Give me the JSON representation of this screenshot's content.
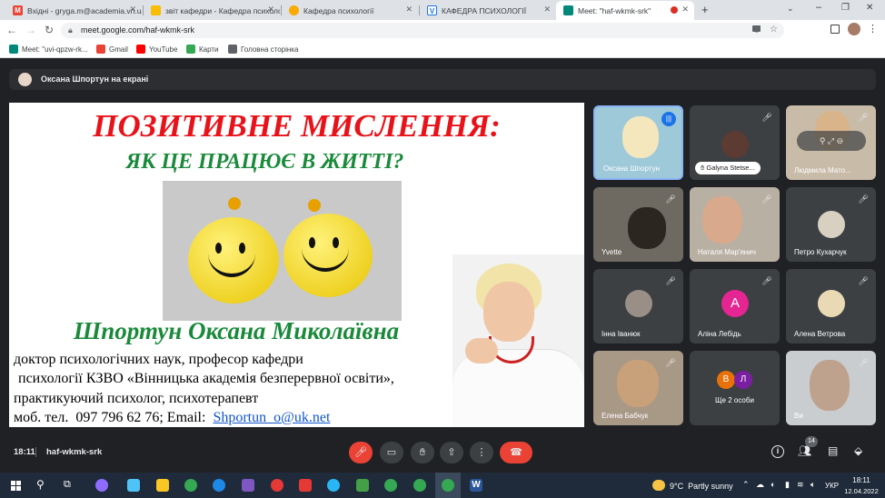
{
  "tabs": [
    {
      "label": "Вхідні - gryga.m@academia.vn.ua",
      "icon": "gmail-icon"
    },
    {
      "label": "звіт кафедри - Кафедра психології",
      "icon": "drive-icon"
    },
    {
      "label": "Кафедра психології",
      "icon": "star-icon"
    },
    {
      "label": "КАФЕДРА ПСИХОЛОГІЇ",
      "icon": "site-icon"
    },
    {
      "label": "Meet: \"haf-wkmk-srk\"",
      "icon": "meet-icon"
    }
  ],
  "address": {
    "url": "meet.google.com/haf-wkmk-srk"
  },
  "bookmarks": [
    {
      "label": "Meet: \"uvi-qpzw-rk...",
      "color": "#00897b"
    },
    {
      "label": "Gmail",
      "color": "#ea4335"
    },
    {
      "label": "YouTube",
      "color": "#ff0000"
    },
    {
      "label": "Карти",
      "color": "#34a853"
    },
    {
      "label": "Головна сторінка",
      "color": "#5f6368"
    }
  ],
  "presenting": {
    "text": "Оксана Шпортун на екрані"
  },
  "slide": {
    "title": "ПОЗИТИВНЕ МИСЛЕННЯ:",
    "subtitle": "ЯК ЦЕ ПРАЦЮЄ В ЖИТТІ?",
    "name": "Шпортун Оксана Миколаївна",
    "line1": "доктор психологічних наук, професор кафедри",
    "line2": "психології КЗВО «Вінницька академія безперервної освіти»,",
    "line3": "практикуючий психолог, психотерапевт",
    "line4_prefix": "моб. тел.  097 796 62 76; Email:  ",
    "email": "Shportun_o@uk.net"
  },
  "participants": [
    {
      "name": "Оксана Шпортун",
      "muted": false
    },
    {
      "name": "Galyna Stetse...",
      "muted": true
    },
    {
      "name": "Людмила Мато...",
      "muted": true
    },
    {
      "name": "Yvette",
      "muted": true
    },
    {
      "name": "Наталя Мар'янич",
      "muted": true
    },
    {
      "name": "Петро Кухарчук",
      "muted": true
    },
    {
      "name": "Інна Іванюк",
      "muted": true
    },
    {
      "name": "Аліна Лебідь",
      "muted": true,
      "initial": "A"
    },
    {
      "name": "Алена Ветрова",
      "muted": true
    },
    {
      "name": "Елена Бабчук",
      "muted": true
    },
    {
      "name": "Ще 2 особи",
      "initials": [
        "В",
        "Л"
      ]
    },
    {
      "name": "Ви",
      "muted": true
    }
  ],
  "bottom": {
    "time": "18:11",
    "code": "haf-wkmk-srk",
    "people_count": "14"
  },
  "taskbar": {
    "weather": "9°C  Partly sunny",
    "lang": "УКР",
    "time": "18:11",
    "date": "12.04.2022"
  },
  "colors": {
    "title_red": "#e8131a",
    "subtitle_green": "#1a8a3a",
    "end_call": "#ea4335",
    "accent_blue": "#8ab4f8"
  }
}
